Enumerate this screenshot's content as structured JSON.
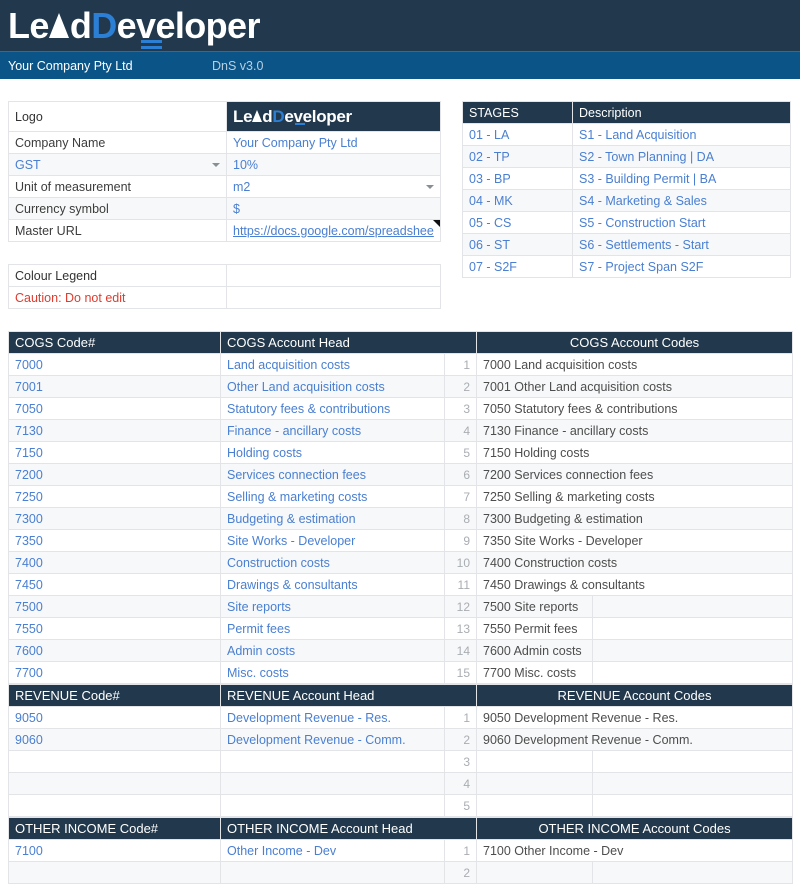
{
  "brand": {
    "logo_text_1": "Le",
    "logo_text_2": "d",
    "logo_text_3": "D",
    "logo_text_4": "eveloper",
    "full_name": "LeadDeveloper"
  },
  "companybar": {
    "company": "Your Company Pty Ltd",
    "version": "DnS v3.0"
  },
  "settings": {
    "rows": [
      {
        "label": "Logo",
        "value": "LeadDeveloper",
        "type": "logo"
      },
      {
        "label": "Company Name",
        "value": "Your Company Pty Ltd",
        "type": "text"
      },
      {
        "label": "GST",
        "value": "10%",
        "type": "label-dropdown"
      },
      {
        "label": "Unit of measurement",
        "value": "m2",
        "type": "value-dropdown"
      },
      {
        "label": "Currency symbol",
        "value": "$",
        "type": "text"
      },
      {
        "label": "Master URL",
        "value": "https://docs.google.com/spreadshee",
        "type": "link"
      }
    ]
  },
  "legend": {
    "title": "Colour Legend",
    "caution": "Caution: Do not edit"
  },
  "stages": {
    "col_code": "STAGES",
    "col_desc": "Description",
    "rows": [
      {
        "code": "01 - LA",
        "desc": "S1 - Land Acquisition"
      },
      {
        "code": "02 - TP",
        "desc": "S2 - Town Planning | DA"
      },
      {
        "code": "03 - BP",
        "desc": "S3 - Building Permit | BA"
      },
      {
        "code": "04 - MK",
        "desc": "S4 - Marketing & Sales"
      },
      {
        "code": "05 - CS",
        "desc": "S5 - Construction Start"
      },
      {
        "code": "06 - ST",
        "desc": "S6 - Settlements - Start"
      },
      {
        "code": "07 - S2F",
        "desc": "S7 - Project Span S2F"
      }
    ]
  },
  "sections": [
    {
      "id": "cogs",
      "col_code": "COGS Code#",
      "col_head": "COGS Account Head",
      "col_codes": "COGS Account Codes",
      "rows": [
        {
          "code": "7000",
          "head": "Land acquisition costs",
          "n": "1",
          "full": "7000 Land acquisition costs"
        },
        {
          "code": "7001",
          "head": "Other Land acquisition costs",
          "n": "2",
          "full": "7001 Other Land acquisition costs"
        },
        {
          "code": "7050",
          "head": "Statutory fees & contributions",
          "n": "3",
          "full": "7050 Statutory fees & contributions"
        },
        {
          "code": "7130",
          "head": "Finance - ancillary costs",
          "n": "4",
          "full": "7130 Finance - ancillary costs"
        },
        {
          "code": "7150",
          "head": "Holding costs",
          "n": "5",
          "full": "7150 Holding costs"
        },
        {
          "code": "7200",
          "head": "Services connection fees",
          "n": "6",
          "full": "7200 Services connection fees"
        },
        {
          "code": "7250",
          "head": "Selling & marketing costs",
          "n": "7",
          "full": "7250 Selling & marketing costs"
        },
        {
          "code": "7300",
          "head": "Budgeting & estimation",
          "n": "8",
          "full": "7300 Budgeting & estimation"
        },
        {
          "code": "7350",
          "head": "Site Works - Developer",
          "n": "9",
          "full": "7350 Site Works - Developer"
        },
        {
          "code": "7400",
          "head": "Construction costs",
          "n": "10",
          "full": "7400 Construction costs"
        },
        {
          "code": "7450",
          "head": "Drawings & consultants",
          "n": "11",
          "full": "7450 Drawings & consultants"
        },
        {
          "code": "7500",
          "head": "Site reports",
          "n": "12",
          "full": "7500 Site reports"
        },
        {
          "code": "7550",
          "head": "Permit fees",
          "n": "13",
          "full": "7550 Permit fees"
        },
        {
          "code": "7600",
          "head": "Admin costs",
          "n": "14",
          "full": "7600 Admin costs"
        },
        {
          "code": "7700",
          "head": "Misc. costs",
          "n": "15",
          "full": "7700 Misc. costs"
        }
      ]
    },
    {
      "id": "revenue",
      "col_code": "REVENUE Code#",
      "col_head": "REVENUE Account Head",
      "col_codes": "REVENUE Account Codes",
      "rows": [
        {
          "code": "9050",
          "head": "Development Revenue - Res.",
          "n": "1",
          "full": "9050 Development Revenue - Res."
        },
        {
          "code": "9060",
          "head": "Development Revenue - Comm.",
          "n": "2",
          "full": "9060 Development Revenue - Comm."
        },
        {
          "code": "",
          "head": "",
          "n": "3",
          "full": ""
        },
        {
          "code": "",
          "head": "",
          "n": "4",
          "full": ""
        },
        {
          "code": "",
          "head": "",
          "n": "5",
          "full": ""
        }
      ]
    },
    {
      "id": "other-income",
      "col_code": "OTHER INCOME Code#",
      "col_head": "OTHER INCOME Account Head",
      "col_codes": "OTHER INCOME Account Codes",
      "rows": [
        {
          "code": "7100",
          "head": "Other Income - Dev",
          "n": "1",
          "full": "7100 Other Income - Dev"
        },
        {
          "code": "",
          "head": "",
          "n": "2",
          "full": ""
        }
      ]
    }
  ],
  "colors": {
    "navy": "#22394d",
    "blue_bar": "#0b5487",
    "link_blue": "#4a7fd1",
    "accent_blue": "#2b7fd4",
    "caution_red": "#e03b2e",
    "stripe": "#f7f8f9",
    "grid_line": "#e2e4e7"
  }
}
